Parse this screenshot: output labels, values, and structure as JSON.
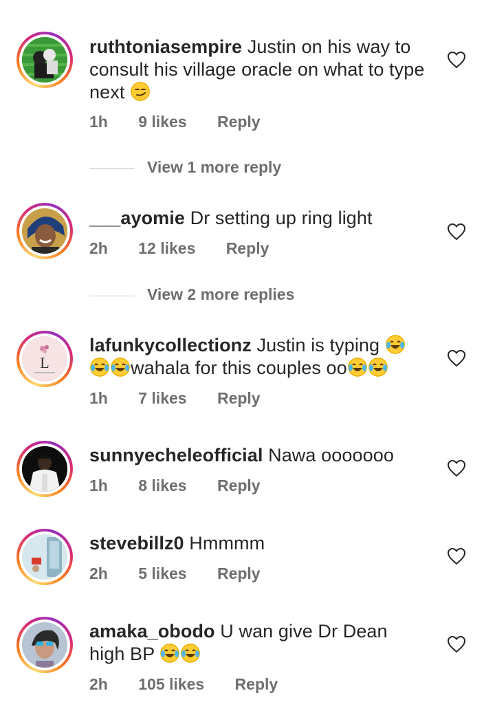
{
  "comments": [
    {
      "username": "ruthtoniasempire",
      "text": "Justin  on his way to consult his village oracle on what to type next",
      "emoji_after": [
        "smirk-emoji"
      ],
      "time": "1h",
      "likes": "9 likes",
      "reply": "Reply",
      "view_more": "View 1 more reply"
    },
    {
      "username": "___ayomie",
      "text": "Dr setting up ring light",
      "time": "2h",
      "likes": "12 likes",
      "reply": "Reply",
      "view_more": "View 2 more replies"
    },
    {
      "username": "lafunkycollectionz",
      "text_part1": "Justin is typing",
      "text_part2": "wahala for this couples oo",
      "time": "1h",
      "likes": "7 likes",
      "reply": "Reply"
    },
    {
      "username": "sunnyecheleofficial",
      "text": "Nawa ooooooo",
      "time": "1h",
      "likes": "8 likes",
      "reply": "Reply"
    },
    {
      "username": "stevebillz0",
      "text": "Hmmmm",
      "time": "2h",
      "likes": "5 likes",
      "reply": "Reply"
    },
    {
      "username": "amaka_obodo",
      "text": "U wan give Dr Dean high BP",
      "time": "2h",
      "likes": "105 likes",
      "reply": "Reply"
    }
  ],
  "avatar_logo_letter": "L",
  "colors": {
    "text": "#262626",
    "meta": "#6e6e6e",
    "emoji": "#ffcc33"
  },
  "icons": {
    "heart": "heart-outline-icon",
    "laugh": "tears-of-joy-emoji",
    "smirk": "smirk-emoji"
  }
}
